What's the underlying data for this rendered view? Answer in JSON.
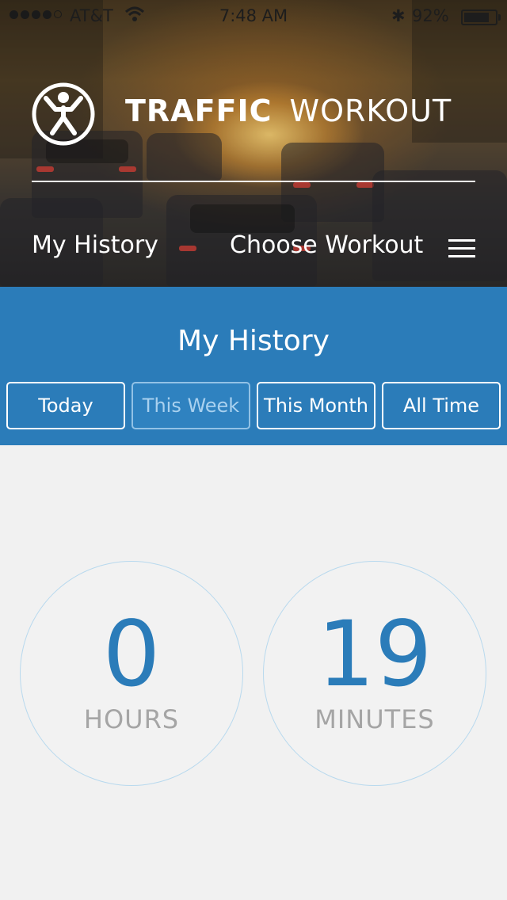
{
  "status_bar": {
    "carrier": "AT&T",
    "time": "7:48 AM",
    "battery_percent": "92%",
    "battery_level": 0.92,
    "signal_bars": 4
  },
  "header": {
    "brand_bold": "TRAFFIC",
    "brand_light": "WORKOUT",
    "nav_history": "My History",
    "nav_choose_workout": "Choose Workout",
    "menu_icon": "hamburger-menu-icon"
  },
  "history": {
    "title": "My History",
    "filters": [
      "Today",
      "This Week",
      "This Month",
      "All Time"
    ],
    "selected_filter": "This Week"
  },
  "stats": {
    "hours_value": "0",
    "hours_label": "HOURS",
    "minutes_value": "19",
    "minutes_label": "MINUTES"
  },
  "colors": {
    "accent_blue": "#2b7cb9",
    "background": "#f1f1f1",
    "label_gray": "#a5a5a5"
  }
}
